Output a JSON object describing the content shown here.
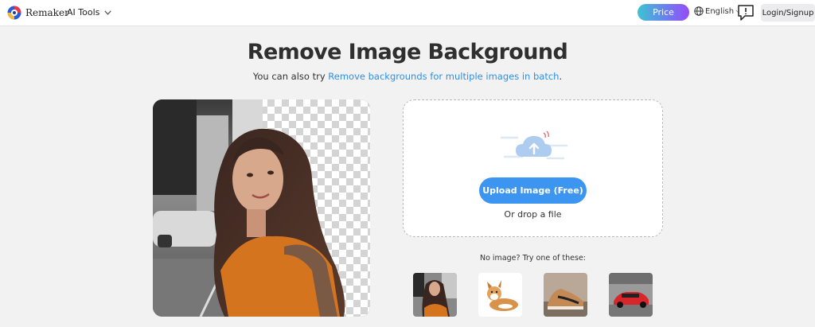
{
  "header": {
    "brand": "Remaker",
    "tools_label": "AI Tools",
    "price_label": "Price",
    "language": "English",
    "login_label": "Login/Signup"
  },
  "main": {
    "title": "Remove Image Background",
    "subtitle_prefix": "You can also try ",
    "subtitle_link": "Remove backgrounds for multiple images in batch",
    "subtitle_suffix": "."
  },
  "upload": {
    "button_label": "Upload Image (Free)",
    "drop_text": "Or drop a file"
  },
  "samples": {
    "label": "No image? Try one of these:"
  },
  "colors": {
    "accent": "#3d95f2",
    "link": "#2f8fe8",
    "price_gradient_start": "#3cc4d0",
    "price_gradient_end": "#9a4af5"
  }
}
